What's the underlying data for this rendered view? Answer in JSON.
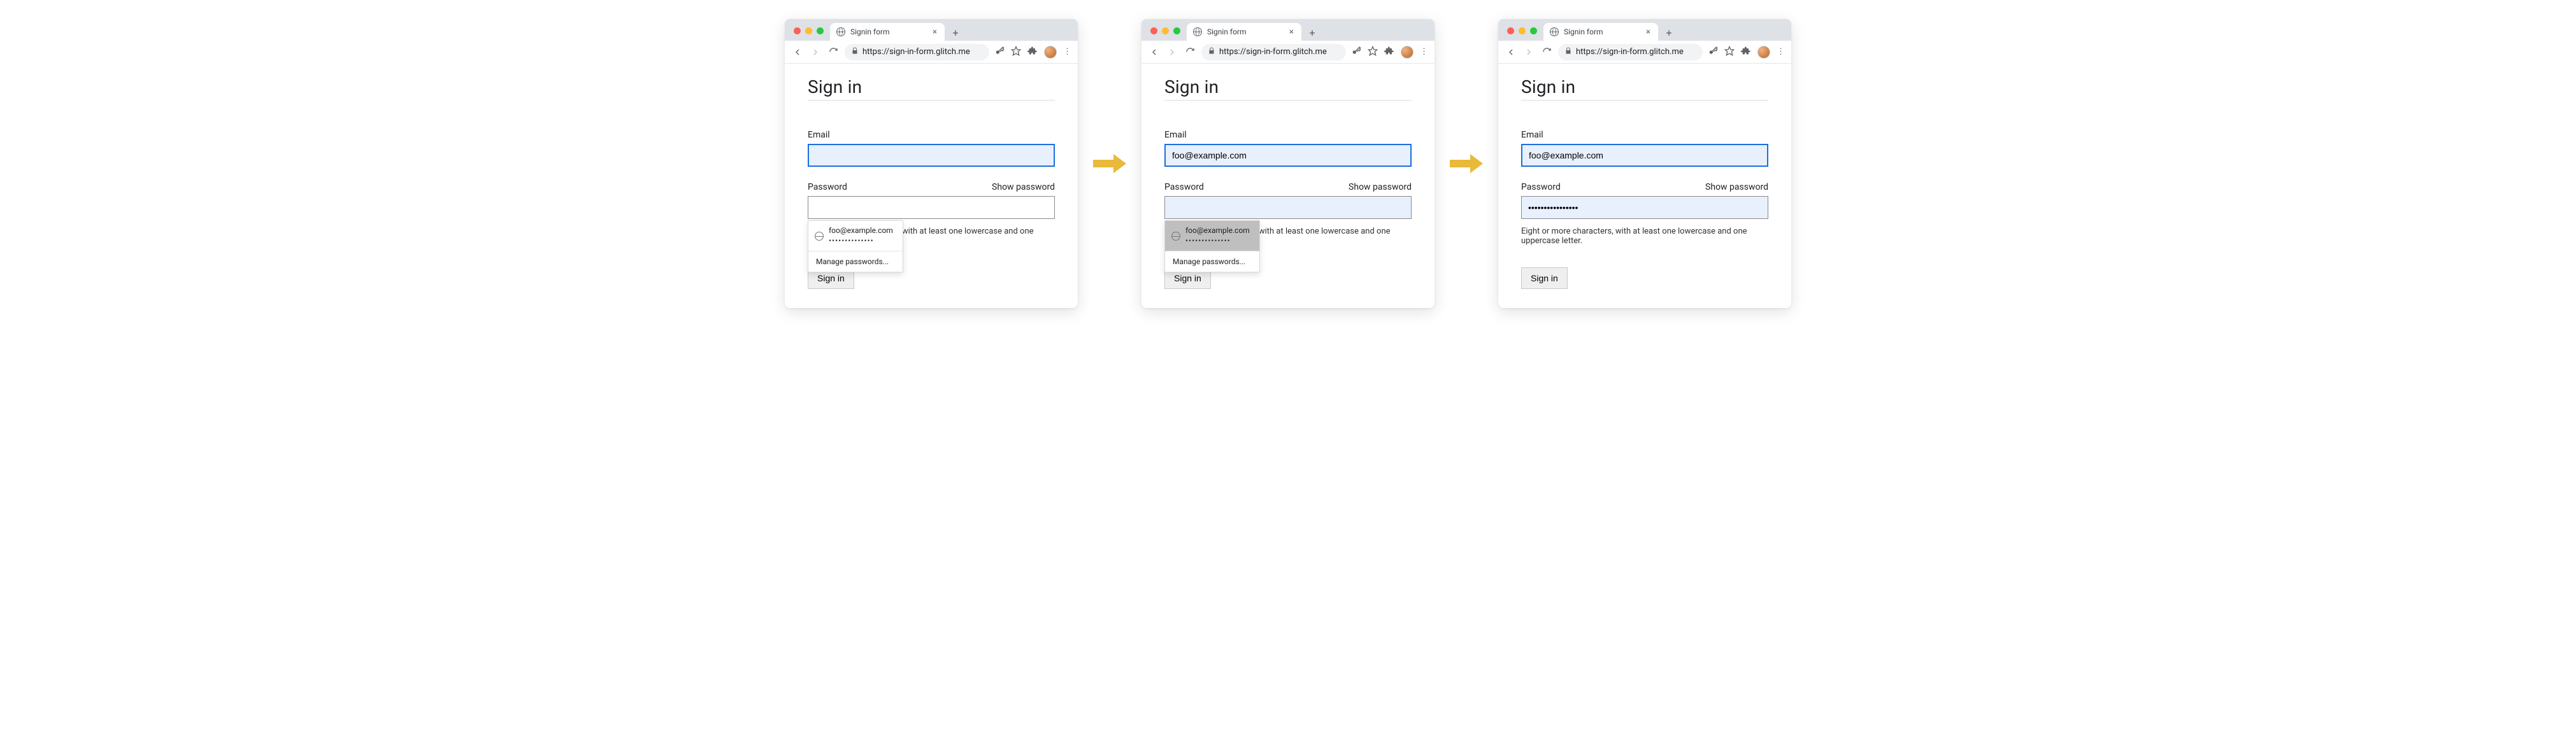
{
  "browser": {
    "tab_title": "Signin form",
    "url_display": "https://sign-in-form.glitch.me"
  },
  "page": {
    "heading": "Sign in",
    "email_label": "Email",
    "password_label": "Password",
    "show_password": "Show password",
    "hint": "Eight or more characters, with at least one lowercase and one uppercase letter.",
    "submit": "Sign in"
  },
  "autofill": {
    "email": "foo@example.com",
    "password_mask": "••••••••••••••",
    "manage": "Manage passwords..."
  },
  "states": {
    "s1": {
      "email_value": "",
      "password_value": "",
      "dropdown_hover": false
    },
    "s2": {
      "email_value": "foo@example.com",
      "password_value": "",
      "dropdown_hover": true
    },
    "s3": {
      "email_value": "foo@example.com",
      "password_value": "••••••••••••••••"
    }
  }
}
